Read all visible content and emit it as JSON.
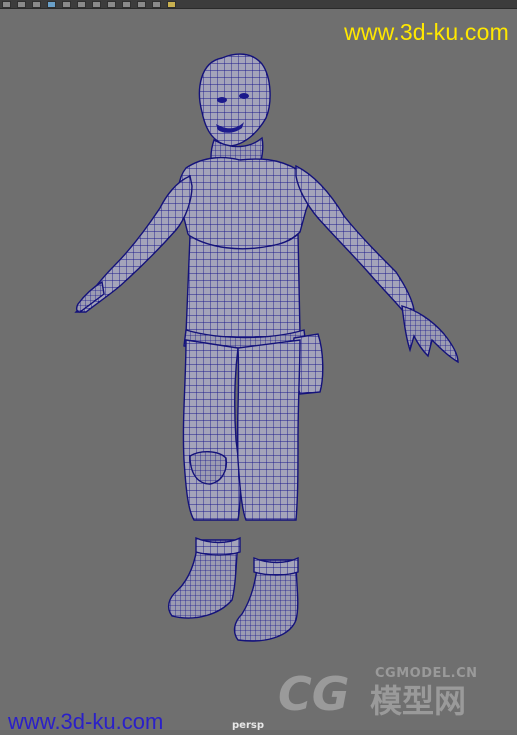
{
  "toolbar": {
    "tools": [
      {
        "name": "select-tool-icon",
        "state": "normal"
      },
      {
        "name": "lasso-tool-icon",
        "state": "normal"
      },
      {
        "name": "paint-select-icon",
        "state": "normal"
      },
      {
        "name": "move-tool-icon",
        "state": "selected"
      },
      {
        "name": "rotate-tool-icon",
        "state": "normal"
      },
      {
        "name": "scale-tool-icon",
        "state": "normal"
      },
      {
        "name": "universal-manipulator-icon",
        "state": "normal"
      },
      {
        "name": "soft-mod-icon",
        "state": "normal"
      },
      {
        "name": "show-manipulator-icon",
        "state": "normal"
      },
      {
        "name": "render-icon",
        "state": "normal"
      },
      {
        "name": "ipr-render-icon",
        "state": "normal"
      },
      {
        "name": "render-settings-icon",
        "state": "gold"
      }
    ]
  },
  "viewport": {
    "camera_label": "persp",
    "watermark_top": "www.3d-ku.com",
    "watermark_bottom": "www.3d-ku.com",
    "logo_small": "CGMODEL.CN",
    "logo_big": "CG",
    "logo_cn": "模型网"
  },
  "colors": {
    "viewport_bg": "#6f6f6f",
    "wireframe": "#1c1a8c",
    "mesh_fill": "#a3a3b8",
    "watermark_top": "#ffe800",
    "watermark_bottom": "#2b20c8"
  }
}
